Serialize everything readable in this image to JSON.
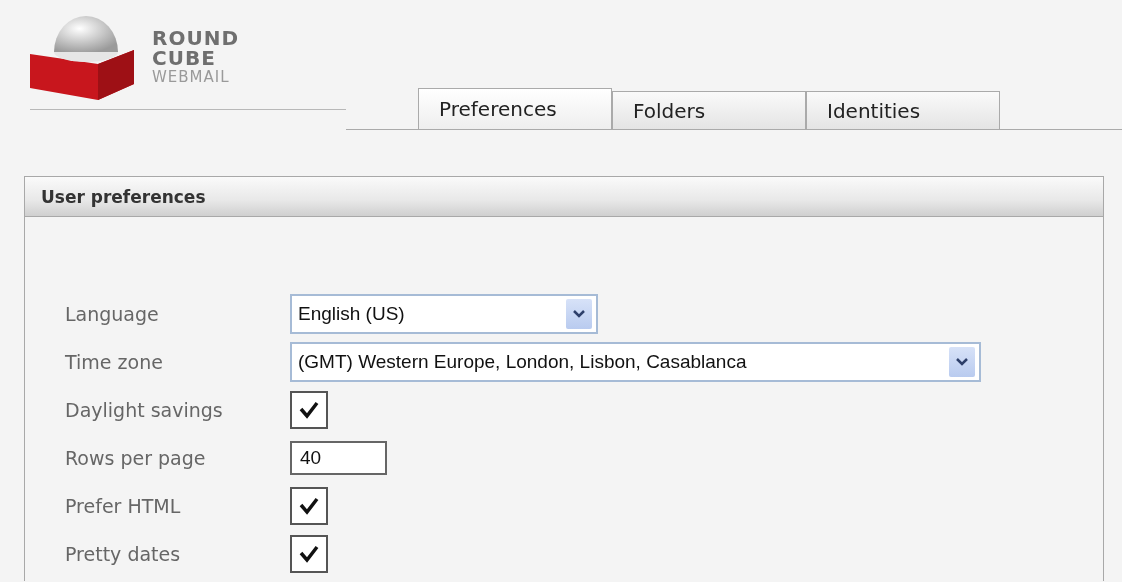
{
  "logo": {
    "lines": [
      "ROUND",
      "CUBE",
      "WEBMAIL"
    ]
  },
  "tabs": [
    {
      "label": "Preferences",
      "selected": true
    },
    {
      "label": "Folders",
      "selected": false
    },
    {
      "label": "Identities",
      "selected": false
    }
  ],
  "panel": {
    "title": "User preferences",
    "rows": [
      {
        "label": "Language",
        "kind": "select",
        "value": "English (US)"
      },
      {
        "label": "Time zone",
        "kind": "select",
        "value": "(GMT) Western Europe, London, Lisbon, Casablanca"
      },
      {
        "label": "Daylight savings",
        "kind": "checkbox",
        "checked": true
      },
      {
        "label": "Rows per page",
        "kind": "text",
        "value": "40"
      },
      {
        "label": "Prefer HTML",
        "kind": "checkbox",
        "checked": true
      },
      {
        "label": "Pretty dates",
        "kind": "checkbox",
        "checked": true
      }
    ]
  }
}
